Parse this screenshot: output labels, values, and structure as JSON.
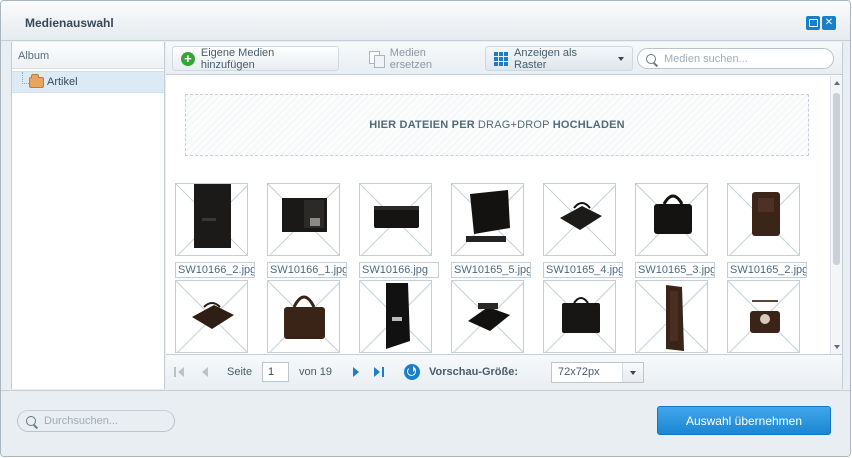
{
  "window": {
    "title": "Medienauswahl"
  },
  "sidebar": {
    "header": "Album",
    "items": [
      {
        "label": "Artikel"
      }
    ]
  },
  "toolbar": {
    "add_label": "Eigene Medien hinzufügen",
    "replace_label": "Medien ersetzen",
    "view_label": "Anzeigen als Raster",
    "search_placeholder": "Medien suchen..."
  },
  "dropzone": {
    "part1": "HIER DATEIEN PER",
    "part2": "DRAG+DROP",
    "part3": "HOCHLADEN"
  },
  "media": {
    "items": [
      {
        "name": "SW10166_2.jpg"
      },
      {
        "name": "SW10166_1.jpg"
      },
      {
        "name": "SW10166.jpg"
      },
      {
        "name": "SW10165_5.jpg"
      },
      {
        "name": "SW10165_4.jpg"
      },
      {
        "name": "SW10165_3.jpg"
      },
      {
        "name": "SW10165_2.jpg"
      },
      {
        "name": ""
      },
      {
        "name": ""
      },
      {
        "name": ""
      },
      {
        "name": ""
      },
      {
        "name": ""
      },
      {
        "name": ""
      },
      {
        "name": ""
      }
    ]
  },
  "pager": {
    "page_label": "Seite",
    "current_page": "1",
    "of_label": "von 19",
    "preview_size_label": "Vorschau-Größe:",
    "preview_size_value": "72x72px"
  },
  "footer": {
    "search_placeholder": "Durchsuchen...",
    "apply_label": "Auswahl übernehmen"
  },
  "colors": {
    "accent": "#1a7fc9",
    "apply_button": "#2a95de",
    "add_icon": "#3aa23a",
    "folder": "#e8a55c"
  }
}
